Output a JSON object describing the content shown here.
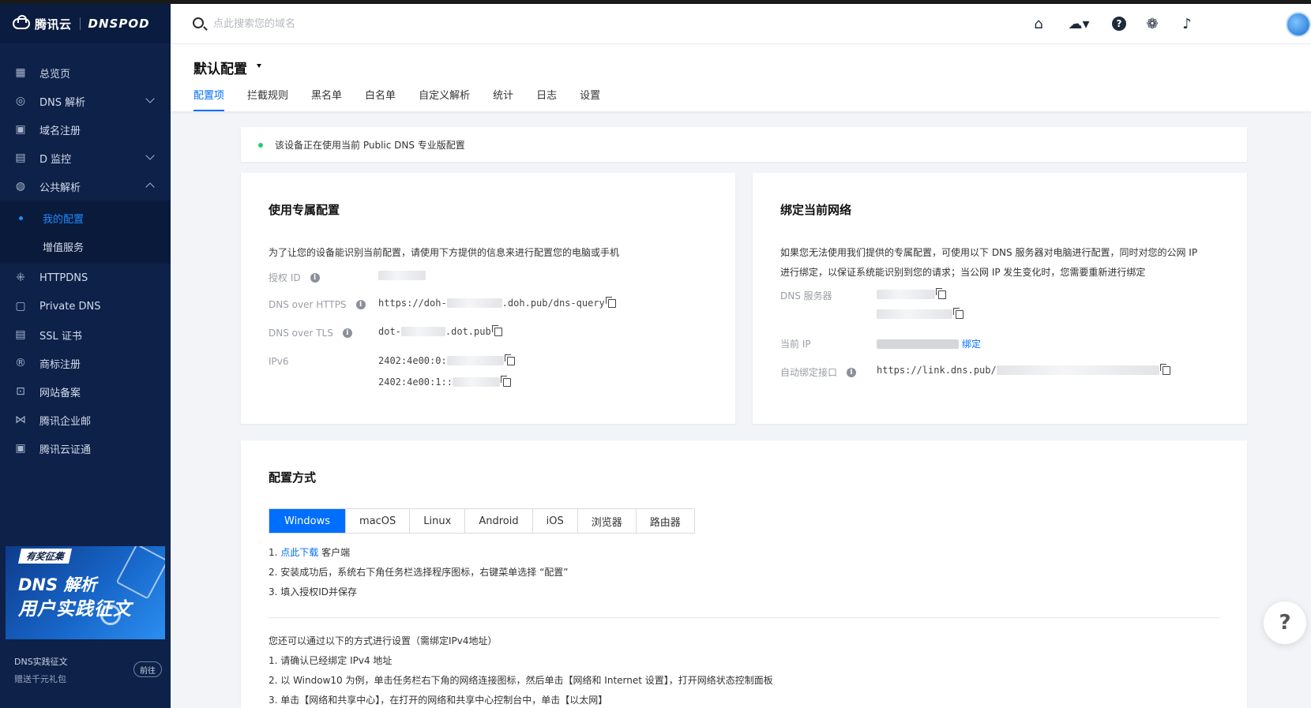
{
  "brand": {
    "cloud_name": "腾讯云",
    "product": "DNSPOD"
  },
  "sidebar": {
    "items": [
      {
        "label": "总览页",
        "icon": "grid-icon"
      },
      {
        "label": "DNS 解析",
        "icon": "globe-icon",
        "expand": "down"
      },
      {
        "label": "域名注册",
        "icon": "register-icon"
      },
      {
        "label": "D 监控",
        "icon": "monitor-icon",
        "expand": "down"
      },
      {
        "label": "公共解析",
        "icon": "public-dns-icon",
        "expand": "up"
      }
    ],
    "sub_items": [
      {
        "label": "我的配置",
        "active": true
      },
      {
        "label": "增值服务",
        "active": false
      }
    ],
    "items_after": [
      {
        "label": "HTTPDNS",
        "icon": "httpdns-icon"
      },
      {
        "label": "Private DNS",
        "icon": "private-dns-icon"
      },
      {
        "label": "SSL 证书",
        "icon": "ssl-icon"
      },
      {
        "label": "商标注册",
        "icon": "trademark-icon"
      },
      {
        "label": "网站备案",
        "icon": "filing-icon"
      },
      {
        "label": "腾讯企业邮",
        "icon": "mail-icon"
      },
      {
        "label": "腾讯云证通",
        "icon": "cert-icon"
      }
    ],
    "promo": {
      "tag": "有奖征集",
      "title_line1": "DNS 解析",
      "title_line2": "用户实践征文",
      "caption1": "DNS实践征文",
      "caption2": "赠送千元礼包",
      "button": "前往"
    }
  },
  "topbar": {
    "search_placeholder": "点此搜索您的域名",
    "icons": [
      "home-icon",
      "cloud-icon",
      "help-icon",
      "wechat-icon",
      "bell-icon"
    ]
  },
  "page": {
    "title": "默认配置",
    "tabs": [
      "配置项",
      "拦截规则",
      "黑名单",
      "白名单",
      "自定义解析",
      "统计",
      "日志",
      "设置"
    ],
    "active_tab": 0
  },
  "notice": {
    "text": "该设备正在使用当前 Public DNS 专业版配置",
    "status_color": "#29cc6a"
  },
  "dedicated": {
    "title": "使用专属配置",
    "desc": "为了让您的设备能识别当前配置，请使用下方提供的信息来进行配置您的电脑或手机",
    "auth_label": "授权 ID",
    "doh_label": "DNS over HTTPS",
    "doh_prefix": "https://doh-",
    "doh_suffix": ".doh.pub/dns-query",
    "dot_label": "DNS over TLS",
    "dot_prefix": "dot-",
    "dot_suffix": ".dot.pub",
    "ipv6_label": "IPv6",
    "ipv6_1": "2402:4e00:0:",
    "ipv6_2": "2402:4e00:1::"
  },
  "bind": {
    "title": "绑定当前网络",
    "desc_line1": "如果您无法使用我们提供的专属配置，可使用以下 DNS 服务器对电脑进行配置，同时对您的公网 IP",
    "desc_line2": "进行绑定，以保证系统能识别到您的请求；当公网 IP 发生变化时，您需要重新进行绑定",
    "dns_server_label": "DNS 服务器",
    "current_ip_label": "当前 IP",
    "bind_link": "绑定",
    "auto_bind_label": "自动绑定接口",
    "auto_bind_prefix": "https://link.dns.pub/"
  },
  "config_method": {
    "title": "配置方式",
    "platforms": [
      "Windows",
      "macOS",
      "Linux",
      "Android",
      "iOS",
      "浏览器",
      "路由器"
    ],
    "active_platform": 0,
    "step1_prefix": "1. ",
    "step1_link": "点此下载",
    "step1_suffix": " 客户端",
    "step2": "2. 安装成功后，系统右下角任务栏选择程序图标，右键菜单选择 “配置”",
    "step3": "3. 填入授权ID并保存",
    "alt_intro": "您还可以通过以下的方式进行设置（需绑定IPv4地址）",
    "alt1": "1. 请确认已经绑定 IPv4 地址",
    "alt2": "2. 以 Window10 为例，单击任务栏右下角的网络连接图标，然后单击【网络和 Internet 设置】，打开网络状态控制面板",
    "alt3": "3. 单击【网络和共享中心】，在打开的网络和共享中心控制台中，单击【以太网】"
  },
  "help_bubble": "?",
  "colors": {
    "sidebar_bg": "#0d2149",
    "accent": "#006eff",
    "page_bg": "#f2f4f8"
  }
}
